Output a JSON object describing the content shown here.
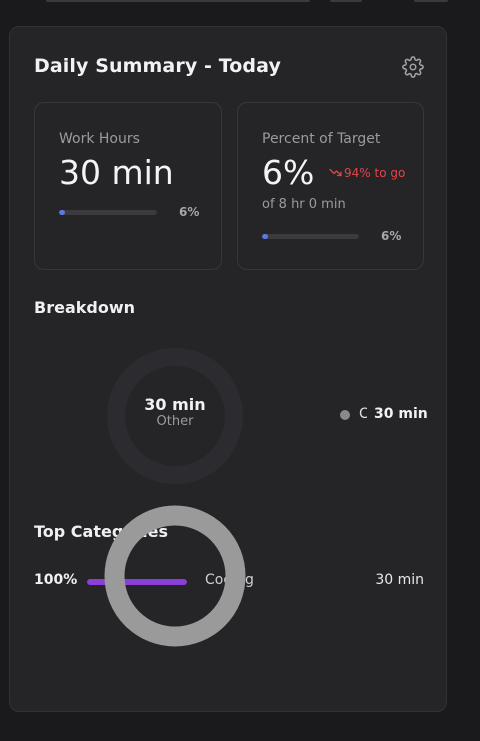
{
  "card": {
    "title": "Daily Summary - Today",
    "settings_icon": "gear-icon"
  },
  "stats": [
    {
      "label": "Work Hours",
      "value": "30 min",
      "progress_pct": 6,
      "progress_text": "6%"
    },
    {
      "label": "Percent of Target",
      "value": "6%",
      "trend_icon": "trending-down-icon",
      "trend_text": "94% to go",
      "subtext": "of 8 hr 0 min",
      "progress_pct": 6,
      "progress_text": "6%"
    }
  ],
  "breakdown": {
    "title": "Breakdown",
    "center_value": "30 min",
    "center_label": "Other",
    "legend": [
      {
        "name": "Coding",
        "value": "30 min",
        "color": "#8a8a8e"
      }
    ]
  },
  "top_categories": {
    "title": "Top Categories",
    "items": [
      {
        "percent": "100%",
        "fill_pct": 100,
        "name": "Coding",
        "value": "30 min",
        "color": "#8a3fd6"
      }
    ]
  },
  "colors": {
    "accent_blue": "#5a78e8",
    "accent_purple": "#8a3fd6",
    "trend_red": "#e0454a",
    "donut_grey": "#9a9a9a"
  }
}
